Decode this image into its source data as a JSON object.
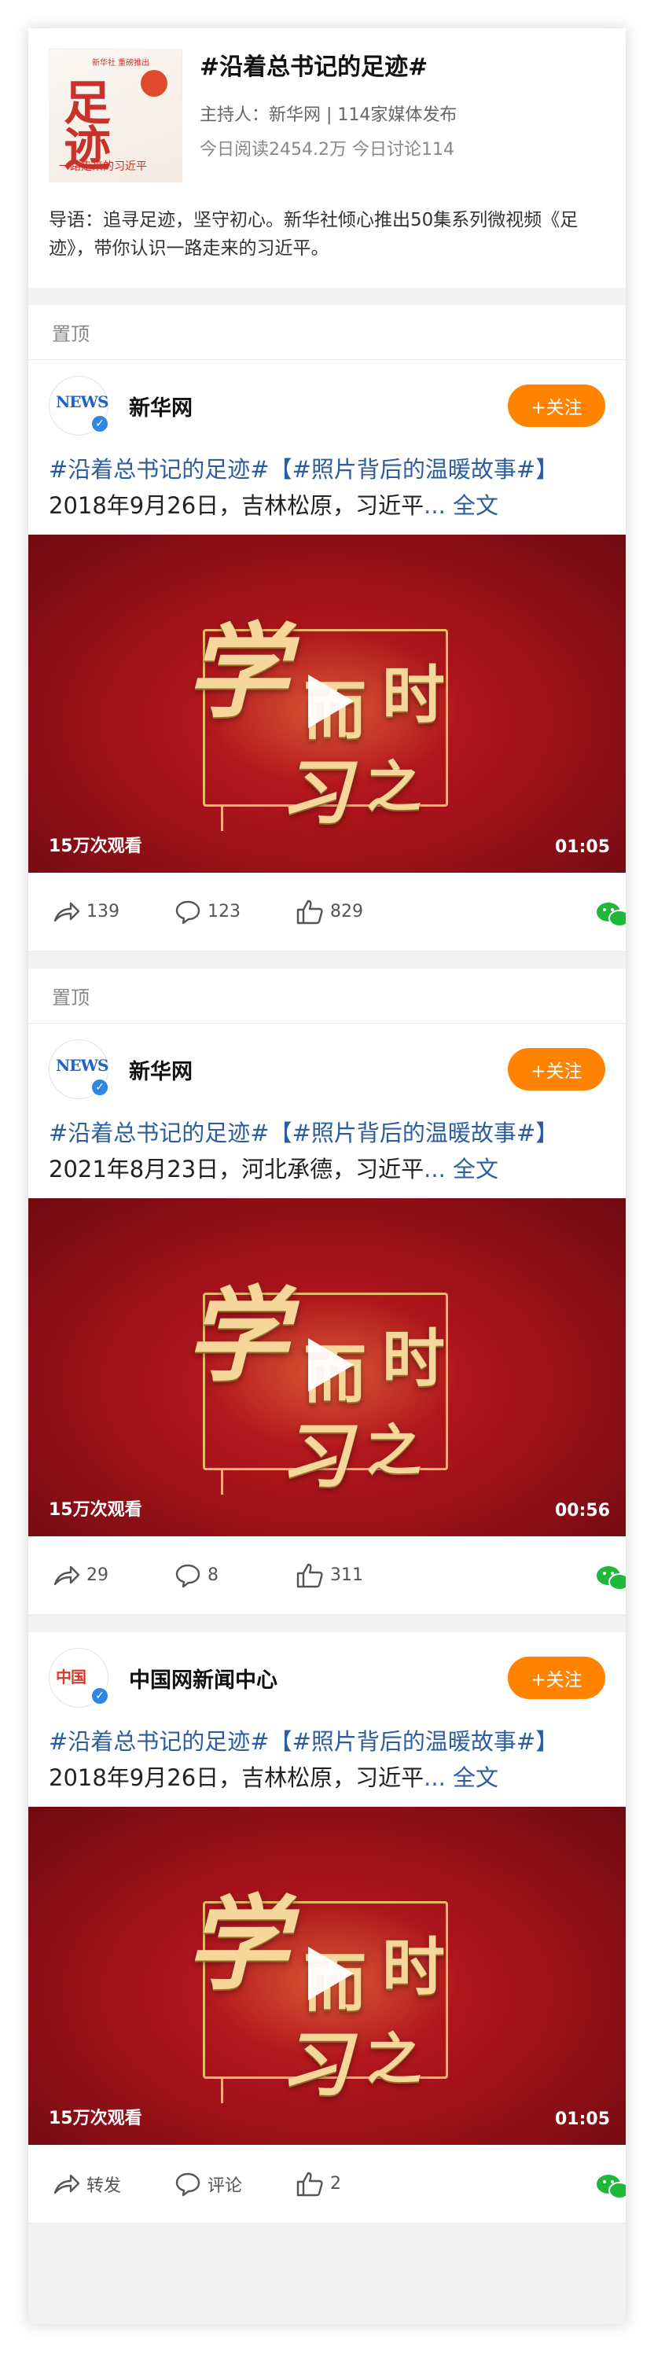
{
  "topic": {
    "title": "#沿着总书记的足迹#",
    "host": "主持人：新华网 | 114家媒体发布",
    "stats": "今日阅读2454.2万  今日讨论114",
    "intro": "导语：追寻足迹，坚守初心。新华社倾心推出50集系列微视频《足\n迹》，带你认识一路走来的习近平。",
    "cover": {
      "title_line1": "足",
      "title_line2": "迹",
      "subtitle": "一路走来的习近平",
      "mini": "新华社 重磅推出"
    }
  },
  "posts": [
    {
      "pin_label": "置顶",
      "author": "新华网",
      "follow_label": "+关注",
      "hashtag1": "#沿着总书记的足迹#",
      "hashtag2": "【#照片背后的温暖故事#】",
      "text": "2018年9月26日，吉林松原，习近平",
      "ellipsis": "... ",
      "full_label": "全文",
      "views": "15万次观看",
      "duration": "01:05",
      "shares": "139",
      "comments": "123",
      "likes": "829",
      "verified": true
    },
    {
      "pin_label": "置顶",
      "author": "新华网",
      "follow_label": "+关注",
      "hashtag1": "#沿着总书记的足迹#",
      "hashtag2": "【#照片背后的温暖故事#】",
      "text": "2021年8月23日，河北承德，习近平",
      "ellipsis": "... ",
      "full_label": "全文",
      "views": "15万次观看",
      "duration": "00:56",
      "shares": "29",
      "comments": "8",
      "likes": "311",
      "verified": true
    },
    {
      "pin_label": "",
      "author": "中国网新闻中心",
      "follow_label": "+关注",
      "hashtag1": "#沿着总书记的足迹#",
      "hashtag2": "【#照片背后的温暖故事#】",
      "text": "2018年9月26日，吉林松原，习近平",
      "ellipsis": "... ",
      "full_label": "全文",
      "views": "15万次观看",
      "duration": "01:05",
      "shares": "转发",
      "comments": "评论",
      "likes": "2",
      "verified": true
    }
  ],
  "video_title_chars": [
    "学",
    "而",
    "时",
    "习",
    "之"
  ],
  "colors": {
    "accent": "#ff8200",
    "link": "#2d5d9f",
    "video_red": "#a5121a"
  }
}
